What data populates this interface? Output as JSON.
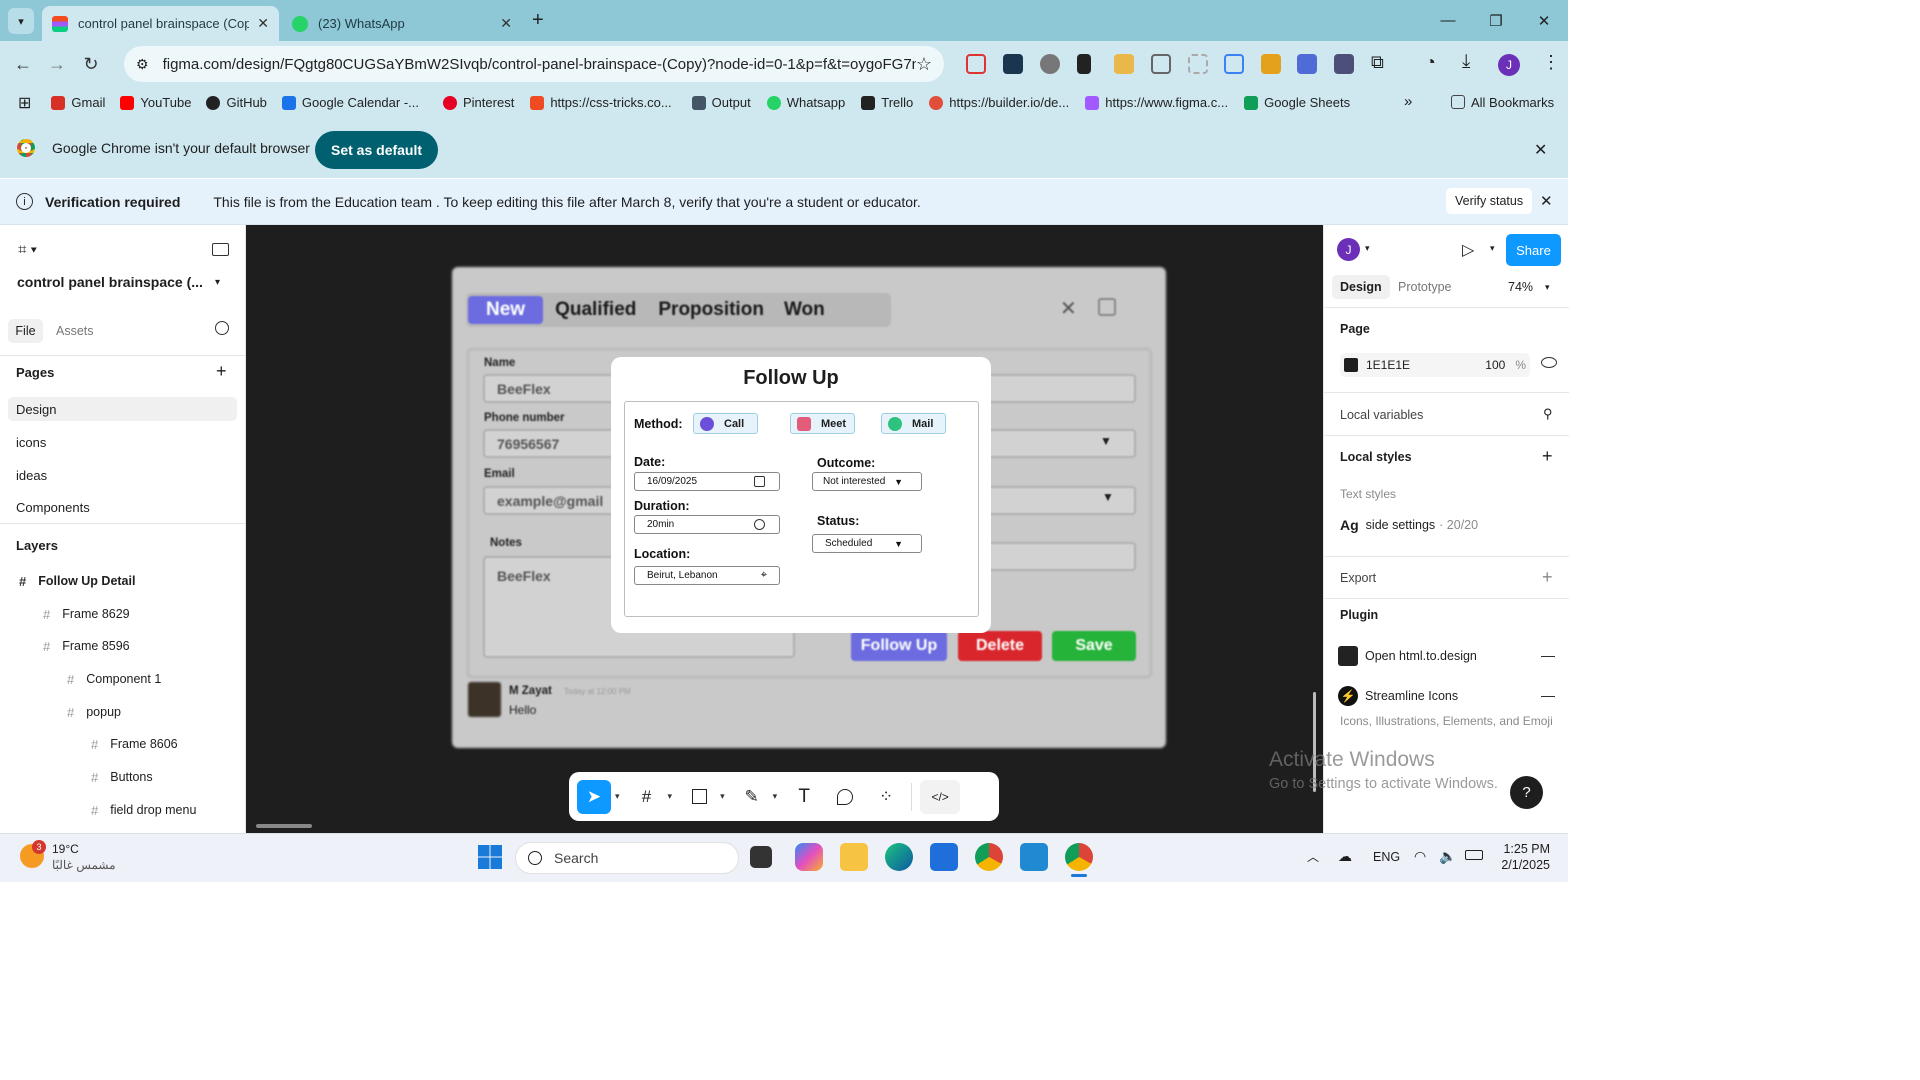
{
  "browser": {
    "tabs": [
      {
        "title": "control panel brainspace (Copy)",
        "active": true
      },
      {
        "title": "(23) WhatsApp",
        "active": false
      }
    ],
    "url": "figma.com/design/FQgtg80CUGSaYBmW2SIvqb/control-panel-brainspace-(Copy)?node-id=0-1&p=f&t=oygoFG7nf...",
    "profile_initial": "J",
    "bookmarks": [
      {
        "label": "Gmail",
        "color": "#d93025"
      },
      {
        "label": "YouTube",
        "color": "#ff0000"
      },
      {
        "label": "GitHub",
        "color": "#222222"
      },
      {
        "label": "Google Calendar -...",
        "color": "#1a73e8"
      },
      {
        "label": "Pinterest",
        "color": "#e60023"
      },
      {
        "label": "https://css-tricks.co...",
        "color": "#ef4b23"
      },
      {
        "label": "Output",
        "color": "#445566"
      },
      {
        "label": "Whatsapp",
        "color": "#25d366"
      },
      {
        "label": "Trello",
        "color": "#222222"
      },
      {
        "label": "https://builder.io/de...",
        "color": "#e14f3c"
      },
      {
        "label": "https://www.figma.c...",
        "color": "#a259ff"
      },
      {
        "label": "Google Sheets",
        "color": "#0f9d58"
      }
    ],
    "all_bookmarks": "All Bookmarks",
    "default_browser_msg": "Google Chrome isn't your default browser",
    "set_default": "Set as default"
  },
  "verify": {
    "title": "Verification required",
    "message": "This file is from the Education team . To keep editing this file after March 8, verify that you're a student or educator.",
    "button": "Verify status"
  },
  "left": {
    "file_name": "control panel brainspace (...",
    "tab_file": "File",
    "tab_assets": "Assets",
    "pages_title": "Pages",
    "pages": [
      "Design",
      "icons",
      "ideas",
      "Components"
    ],
    "layers_title": "Layers",
    "layers": [
      {
        "label": "Follow Up Detail",
        "depth": 0
      },
      {
        "label": "Frame 8629",
        "depth": 1
      },
      {
        "label": "Frame 8596",
        "depth": 1
      },
      {
        "label": "Component 1",
        "depth": 2
      },
      {
        "label": "popup",
        "depth": 2
      },
      {
        "label": "Frame 8606",
        "depth": 3
      },
      {
        "label": "Buttons",
        "depth": 3
      },
      {
        "label": "field drop menu",
        "depth": 3
      }
    ]
  },
  "mock": {
    "tabs": [
      "New",
      "Qualified",
      "Proposition",
      "Won"
    ],
    "name_label": "Name",
    "name_value": "BeeFlex",
    "phone_label": "Phone number",
    "phone_value": "76956567",
    "email_label": "Email",
    "email_value": "example@gmail",
    "notes_label": "Notes",
    "notes_value": "BeeFlex",
    "btn_follow": "Follow Up",
    "btn_delete": "Delete",
    "btn_save": "Save",
    "comment_author": "M Zayat",
    "comment_time": "Today at 12:00 PM",
    "comment_text": "Hello"
  },
  "modal": {
    "title": "Follow Up",
    "method_label": "Method:",
    "methods": [
      "Call",
      "Meet",
      "Mail"
    ],
    "date_label": "Date:",
    "date_value": "16/09/2025",
    "duration_label": "Duration:",
    "duration_value": "20min",
    "location_label": "Location:",
    "location_value": "Beirut, Lebanon",
    "outcome_label": "Outcome:",
    "outcome_value": "Not interested",
    "status_label": "Status:",
    "status_value": "Scheduled"
  },
  "right": {
    "avatar": "J",
    "share": "Share",
    "tab_design": "Design",
    "tab_prototype": "Prototype",
    "zoom": "74%",
    "page_title": "Page",
    "page_color": "1E1E1E",
    "page_opacity": "100",
    "percent": "%",
    "local_variables": "Local variables",
    "local_styles": "Local styles",
    "text_styles": "Text styles",
    "style_ag": "Ag",
    "style_name": "side settings",
    "style_meta": "· 20/20",
    "export": "Export",
    "plugin": "Plugin",
    "plugin1": "Open html.to.design",
    "plugin2": "Streamline Icons",
    "plugin2_desc": "Icons, Illustrations, Elements, and Emoji",
    "watermark_title": "Activate Windows",
    "watermark_sub": "Go to Settings to activate Windows.",
    "help": "?"
  },
  "taskbar": {
    "weather_badge": "3",
    "temp": "19°C",
    "weather_desc": "مشمس غالبًا",
    "search": "Search",
    "lang": "ENG",
    "time": "1:25 PM",
    "date": "2/1/2025"
  },
  "colors": {
    "figma_blue": "#0d99ff",
    "mock_new": "#6c6ce0",
    "follow": "#6c6ce0",
    "delete": "#d9262c",
    "save": "#26b33a",
    "canvas": "#1e1e1e"
  }
}
